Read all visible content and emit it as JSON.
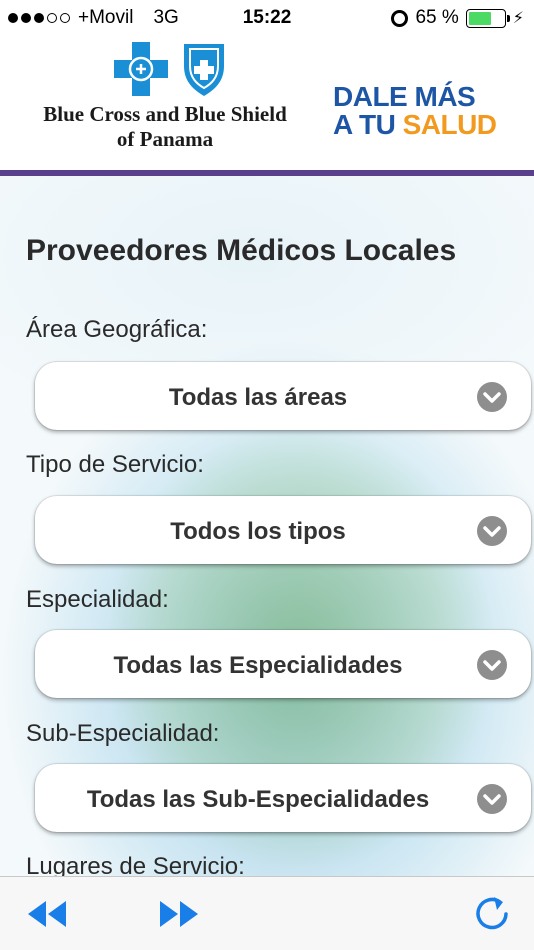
{
  "status": {
    "carrier": "+Movil",
    "network": "3G",
    "time": "15:22",
    "battery": "65 %",
    "signal_bars_filled": 3,
    "signal_bars_total": 5
  },
  "header": {
    "brand_name_line1": "Blue Cross and Blue Shield",
    "brand_name_line2": "of Panama",
    "slogan_line1": "DALE MÁS",
    "slogan_line2_a": "A TU ",
    "slogan_line2_b": "SALUD",
    "colors": {
      "rule": "#5a3f8d",
      "brand_blue": "#1e56a6",
      "accent_orange": "#f29a1f"
    }
  },
  "main": {
    "title": "Proveedores Médicos Locales",
    "fields": [
      {
        "label": "Área Geográfica:",
        "value": "Todas las áreas"
      },
      {
        "label": "Tipo de Servicio:",
        "value": "Todos los tipos"
      },
      {
        "label": "Especialidad:",
        "value": "Todas las Especialidades"
      },
      {
        "label": "Sub-Especialidad:",
        "value": "Todas las Sub-Especialidades"
      },
      {
        "label": "Lugares de Servicio:"
      }
    ]
  },
  "toolbar": {
    "back_icon": "rewind-icon",
    "forward_icon": "fast-forward-icon",
    "refresh_icon": "refresh-icon",
    "color": "#1a7ee8"
  }
}
